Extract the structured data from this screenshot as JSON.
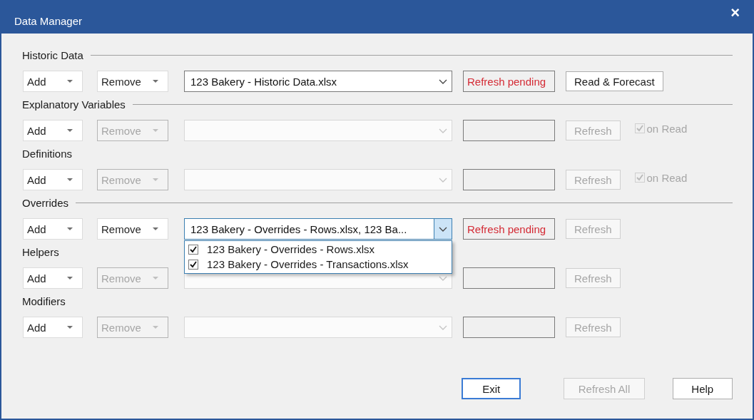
{
  "window": {
    "title": "Data Manager",
    "close_glyph": "×"
  },
  "sections": [
    {
      "title": "Historic Data",
      "ruled": true,
      "add": {
        "label": "Add",
        "disabled": false
      },
      "remove": {
        "label": "Remove",
        "disabled": false
      },
      "file": {
        "value": "123 Bakery - Historic Data.xlsx",
        "disabled": false,
        "open": false
      },
      "status": {
        "text": "Refresh pending"
      },
      "action": {
        "label": "Read & Forecast",
        "disabled": false
      }
    },
    {
      "title": "Explanatory Variables",
      "ruled": true,
      "add": {
        "label": "Add",
        "disabled": false
      },
      "remove": {
        "label": "Remove",
        "disabled": true
      },
      "file": {
        "disabled": true,
        "open": false
      },
      "action": {
        "label": "Refresh",
        "disabled": true
      },
      "on_read": {
        "label": "on Read",
        "checked": true,
        "disabled": true
      }
    },
    {
      "title": "Definitions",
      "ruled": false,
      "add": {
        "label": "Add",
        "disabled": false
      },
      "remove": {
        "label": "Remove",
        "disabled": true
      },
      "file": {
        "disabled": true,
        "open": false
      },
      "action": {
        "label": "Refresh",
        "disabled": true
      },
      "on_read": {
        "label": "on Read",
        "checked": true,
        "disabled": true
      }
    },
    {
      "title": "Overrides",
      "ruled": true,
      "add": {
        "label": "Add",
        "disabled": false
      },
      "remove": {
        "label": "Remove",
        "disabled": false
      },
      "file": {
        "value": "123 Bakery - Overrides - Rows.xlsx, 123 Ba...",
        "disabled": false,
        "open": true,
        "options": [
          {
            "label": "123 Bakery - Overrides - Rows.xlsx",
            "checked": true
          },
          {
            "label": "123 Bakery - Overrides - Transactions.xlsx",
            "checked": true
          }
        ]
      },
      "status": {
        "text": "Refresh pending"
      },
      "action": {
        "label": "Refresh",
        "disabled": true
      }
    },
    {
      "title": "Helpers",
      "ruled": false,
      "add": {
        "label": "Add",
        "disabled": false
      },
      "remove": {
        "label": "Remove",
        "disabled": true
      },
      "file": {
        "disabled": true,
        "open": false
      },
      "action": {
        "label": "Refresh",
        "disabled": true
      }
    },
    {
      "title": "Modifiers",
      "ruled": false,
      "add": {
        "label": "Add",
        "disabled": false
      },
      "remove": {
        "label": "Remove",
        "disabled": true
      },
      "file": {
        "disabled": true,
        "open": false
      },
      "action": {
        "label": "Refresh",
        "disabled": true
      }
    }
  ],
  "buttons": [
    {
      "label": "Exit",
      "focused": true,
      "disabled": false
    },
    {
      "label": "Refresh All",
      "focused": false,
      "disabled": true
    },
    {
      "label": "Help",
      "focused": false,
      "disabled": false
    }
  ]
}
